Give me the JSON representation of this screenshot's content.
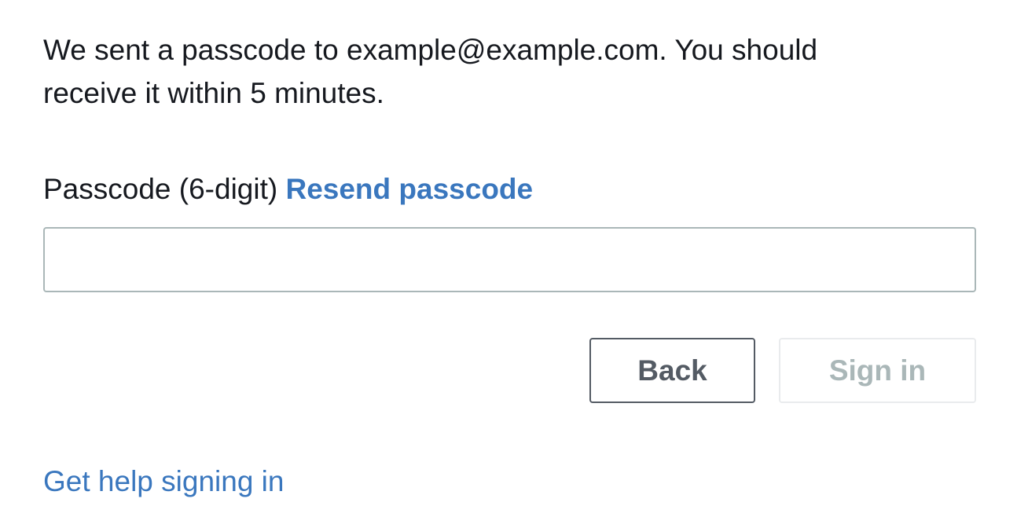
{
  "message": {
    "text": "We sent a passcode to example@example.com. You should receive it within 5 minutes."
  },
  "passcode_field": {
    "label": "Passcode (6-digit)",
    "resend_link": "Resend passcode",
    "value": "",
    "placeholder": ""
  },
  "buttons": {
    "back_label": "Back",
    "sign_in_label": "Sign in",
    "sign_in_disabled": true
  },
  "help": {
    "link_text": "Get help signing in"
  },
  "colors": {
    "link": "#3a77be",
    "text": "#16191f",
    "input_border": "#aab7b8",
    "back_border": "#545b64",
    "disabled_text": "#aab7b8",
    "disabled_border": "#e9ebed"
  }
}
